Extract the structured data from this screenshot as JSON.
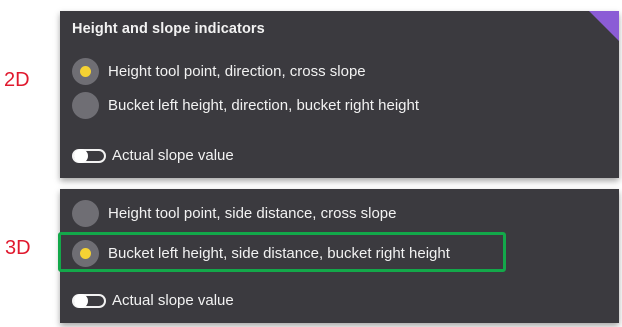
{
  "labels": {
    "two_d": "2D",
    "three_d": "3D"
  },
  "panel_2d": {
    "title": "Height and slope indicators",
    "options": [
      {
        "label": "Height tool point, direction, cross slope",
        "selected": true
      },
      {
        "label": "Bucket left height, direction, bucket right height",
        "selected": false
      }
    ],
    "toggle_label": "Actual slope value",
    "toggle_on": false
  },
  "panel_3d": {
    "options": [
      {
        "label": "Height tool point, side distance, cross slope",
        "selected": false
      },
      {
        "label": "Bucket left height, side distance, bucket right height",
        "selected": true
      }
    ],
    "toggle_label": "Actual slope value",
    "toggle_on": false
  },
  "colors": {
    "panel_bg": "#3b3a3f",
    "radio_off": "#6f6e74",
    "radio_dot": "#f5d233",
    "side_label": "#e0192e",
    "highlight": "#13a84a",
    "corner_accent": "#8b5cd6"
  }
}
